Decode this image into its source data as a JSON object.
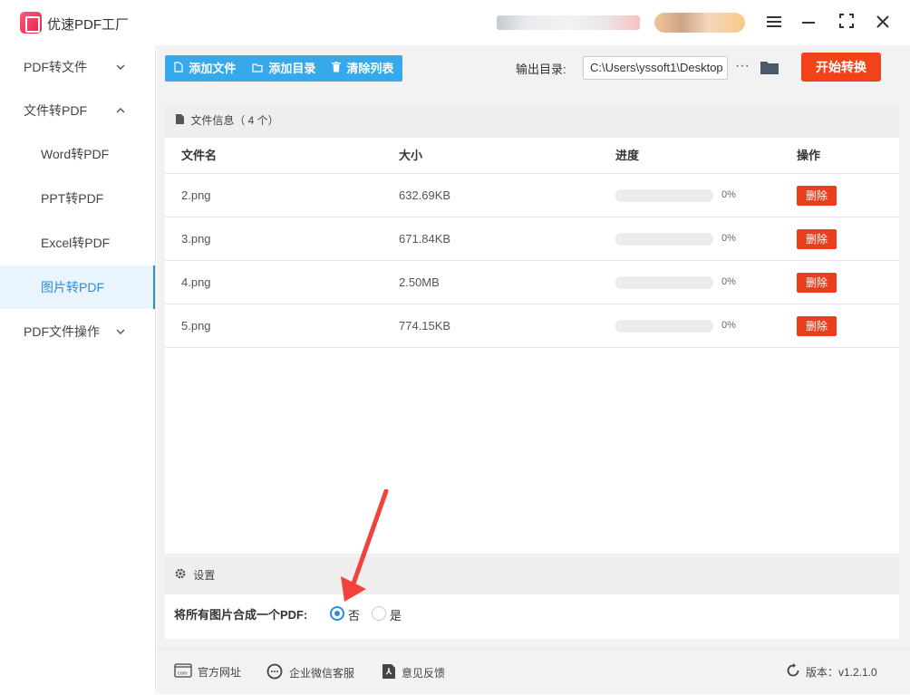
{
  "app": {
    "title": "优速PDF工厂"
  },
  "window": {
    "menu_icon": "hamburger-icon",
    "minimize_icon": "minimize-icon",
    "maximize_icon": "maximize-icon",
    "close_icon": "close-icon"
  },
  "sidebar": {
    "groups": [
      {
        "label": "PDF转文件",
        "expanded": false
      },
      {
        "label": "文件转PDF",
        "expanded": true
      },
      {
        "label": "PDF文件操作",
        "expanded": false
      }
    ],
    "subitems": [
      "Word转PDF",
      "PPT转PDF",
      "Excel转PDF",
      "图片转PDF"
    ],
    "active": "图片转PDF"
  },
  "toolbar": {
    "add_file": "添加文件",
    "add_dir": "添加目录",
    "clear_list": "清除列表",
    "output_label": "输出目录:",
    "output_path": "C:\\Users\\yssoft1\\Desktop",
    "more": "···",
    "start": "开始转换"
  },
  "files": {
    "header": "文件信息（ 4 个）",
    "columns": [
      "文件名",
      "大小",
      "进度",
      "操作"
    ],
    "rows": [
      {
        "name": "2.png",
        "size": "632.69KB",
        "progress_text": "0%",
        "progress": 0,
        "action": "删除"
      },
      {
        "name": "3.png",
        "size": "671.84KB",
        "progress_text": "0%",
        "progress": 0,
        "action": "删除"
      },
      {
        "name": "4.png",
        "size": "2.50MB",
        "progress_text": "0%",
        "progress": 0,
        "action": "删除"
      },
      {
        "name": "5.png",
        "size": "774.15KB",
        "progress_text": "0%",
        "progress": 0,
        "action": "删除"
      }
    ]
  },
  "settings": {
    "header": "设置",
    "merge_label": "将所有图片合成一个PDF:",
    "option_no": "否",
    "option_yes": "是",
    "selected": "否"
  },
  "footer": {
    "website": "官方网址",
    "wechat": "企业微信客服",
    "feedback": "意见反馈",
    "version": "版本：v1.2.1.0"
  },
  "colors": {
    "accent": "#35a9ec",
    "start": "#f0421b",
    "delete": "#e8401c",
    "active": "#2b8be6",
    "annotation_arrow": "#f0443a"
  }
}
